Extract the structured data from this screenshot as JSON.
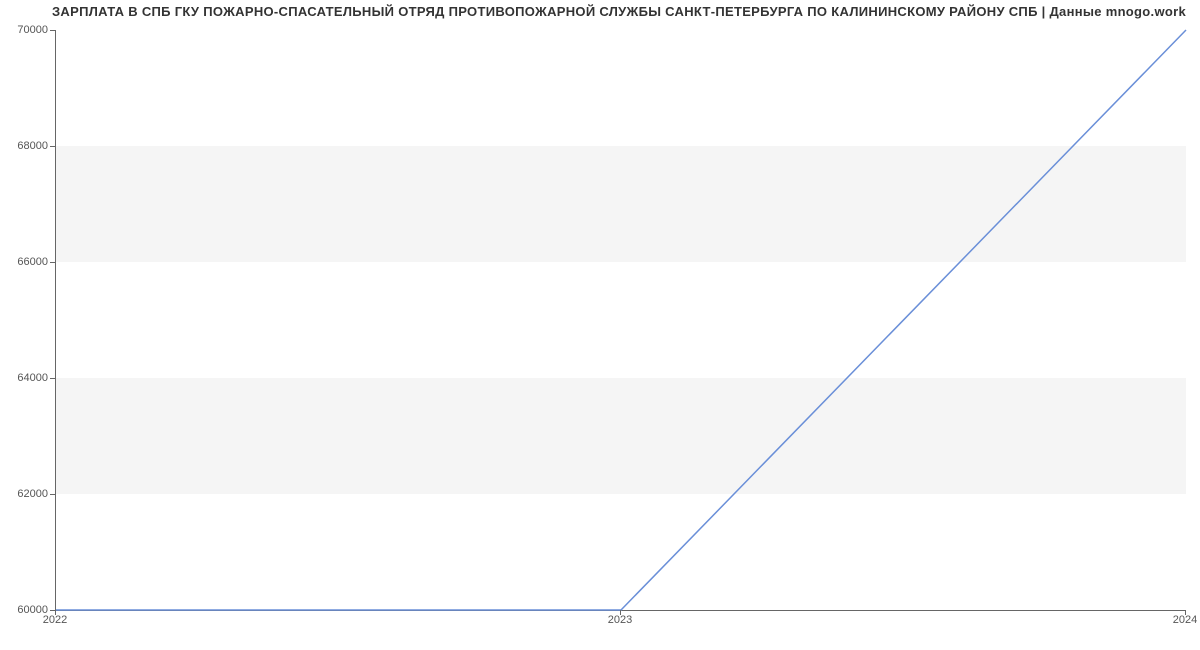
{
  "chart_data": {
    "type": "line",
    "title": "ЗАРПЛАТА В СПБ ГКУ ПОЖАРНО-СПАСАТЕЛЬНЫЙ ОТРЯД ПРОТИВОПОЖАРНОЙ СЛУЖБЫ САНКТ-ПЕТЕРБУРГА ПО КАЛИНИНСКОМУ РАЙОНУ СПБ | Данные mnogo.work",
    "x": [
      "2022",
      "2023",
      "2024"
    ],
    "values": [
      60000,
      60000,
      70000
    ],
    "xlabel": "",
    "ylabel": "",
    "xlim": [
      "2022",
      "2024"
    ],
    "ylim": [
      60000,
      70000
    ],
    "y_ticks": [
      60000,
      62000,
      64000,
      66000,
      68000,
      70000
    ],
    "x_ticks": [
      "2022",
      "2023",
      "2024"
    ],
    "line_color": "#6a8fd8",
    "bands": [
      {
        "from": 62000,
        "to": 64000
      },
      {
        "from": 66000,
        "to": 68000
      }
    ]
  }
}
